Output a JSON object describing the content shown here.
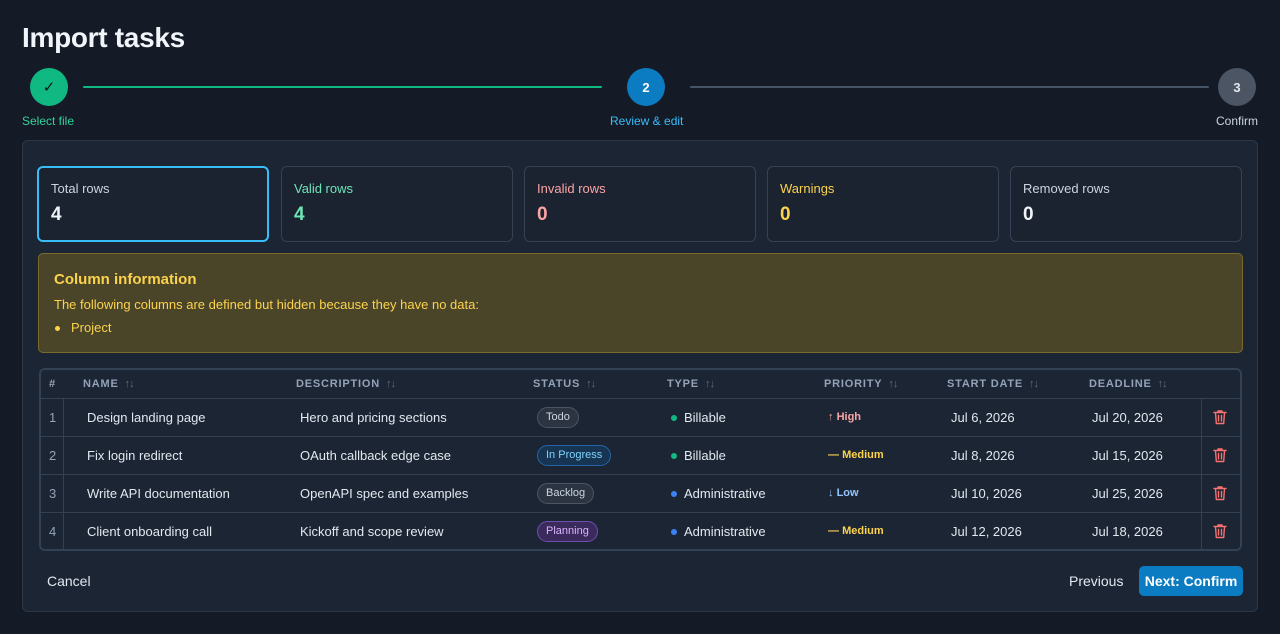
{
  "page": {
    "title": "Import tasks"
  },
  "stepper": {
    "steps": [
      {
        "label": "Select file",
        "marker": "✓",
        "state": "done"
      },
      {
        "label": "Review & edit",
        "marker": "2",
        "state": "current"
      },
      {
        "label": "Confirm",
        "marker": "3",
        "state": "upcoming"
      }
    ]
  },
  "stats": [
    {
      "label": "Total rows",
      "value": "4"
    },
    {
      "label": "Valid rows",
      "value": "4"
    },
    {
      "label": "Invalid rows",
      "value": "0"
    },
    {
      "label": "Warnings",
      "value": "0"
    },
    {
      "label": "Removed rows",
      "value": "0"
    }
  ],
  "column_info": {
    "title": "Column information",
    "text": "The following columns are defined but hidden because they have no data:",
    "items": [
      "Project"
    ]
  },
  "table": {
    "columns": [
      "#",
      "NAME",
      "DESCRIPTION",
      "STATUS",
      "TYPE",
      "PRIORITY",
      "START DATE",
      "DEADLINE"
    ],
    "sort_glyph": "↑↓",
    "rows": [
      {
        "index": "1",
        "name": "Design landing page",
        "description": "Hero and pricing sections",
        "status": "Todo",
        "type": "Billable",
        "priority": "High",
        "priority_glyph": "↑",
        "start_date": "Jul 6, 2026",
        "deadline": "Jul 20, 2026"
      },
      {
        "index": "2",
        "name": "Fix login redirect",
        "description": "OAuth callback edge case",
        "status": "In Progress",
        "type": "Billable",
        "priority": "Medium",
        "priority_glyph": "—",
        "start_date": "Jul 8, 2026",
        "deadline": "Jul 15, 2026"
      },
      {
        "index": "3",
        "name": "Write API documentation",
        "description": "OpenAPI spec and examples",
        "status": "Backlog",
        "type": "Administrative",
        "priority": "Low",
        "priority_glyph": "↓",
        "start_date": "Jul 10, 2026",
        "deadline": "Jul 25, 2026"
      },
      {
        "index": "4",
        "name": "Client onboarding call",
        "description": "Kickoff and scope review",
        "status": "Planning",
        "type": "Administrative",
        "priority": "Medium",
        "priority_glyph": "—",
        "start_date": "Jul 12, 2026",
        "deadline": "Jul 18, 2026"
      }
    ]
  },
  "footer": {
    "cancel_label": "Cancel",
    "previous_label": "Previous",
    "next_label": "Next: Confirm"
  },
  "colors": {
    "accent": "#0b7cc1",
    "success": "#10b981",
    "billable_dot": "#10b981",
    "administrative_dot": "#3b82f6",
    "delete": "#f87171"
  }
}
